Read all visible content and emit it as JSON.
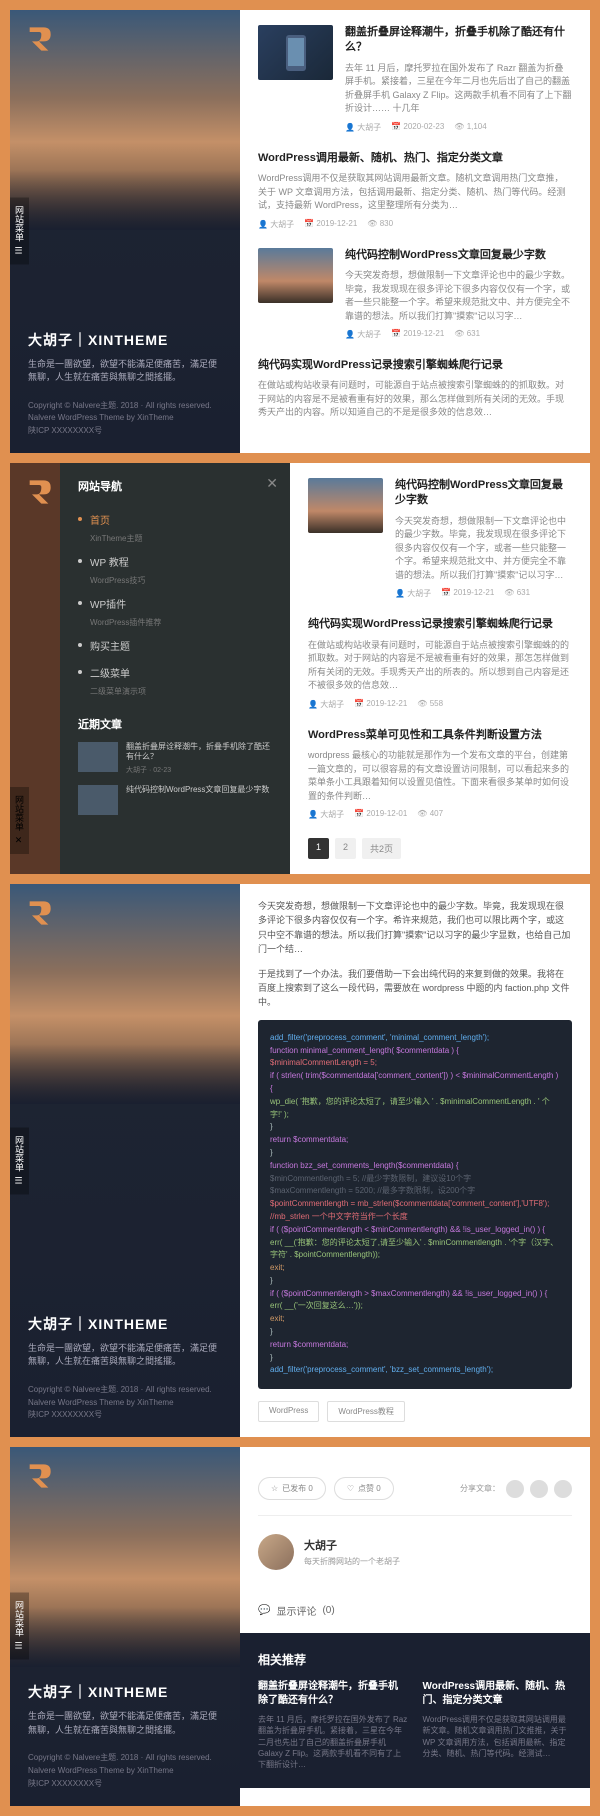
{
  "site": {
    "title": "大胡子｜XINTHEME",
    "desc": "生命是一團欲望，欲望不能滿足便痛苦，滿足便無聊，人生就在痛苦與無聊之間搖擺。",
    "copyright": "Copyright © Nalvere主题. 2018 · All rights reserved.",
    "theme": "Nalvere WordPress Theme by XinTheme",
    "icp": "陕ICP XXXXXXXX号",
    "menu_label": "网站菜单"
  },
  "nav": {
    "title": "网站导航",
    "items": [
      {
        "label": "首页",
        "sub": "XinTheme主题",
        "active": true
      },
      {
        "label": "WP 教程",
        "sub": "WordPress技巧",
        "active": false
      },
      {
        "label": "WP插件",
        "sub": "WordPress插件推荐",
        "active": false
      },
      {
        "label": "购买主题",
        "sub": "",
        "active": false
      },
      {
        "label": "二级菜单",
        "sub": "二级菜单演示项",
        "active": false
      }
    ],
    "recent_title": "近期文章",
    "recent": [
      {
        "title": "翻盖折叠屏诠释潮牛，折叠手机除了酷还有什么？",
        "date": "大胡子 · 02-23"
      },
      {
        "title": "纯代码控制WordPress文章回复最少字数",
        "date": ""
      }
    ]
  },
  "posts_p1": [
    {
      "title": "翻盖折叠屏诠释潮牛，折叠手机除了酷还有什么？",
      "excerpt": "去年 11 月后，摩托罗拉在国外发布了 Razr 翻盖为折叠屏手机。紧接着，三星在今年二月也先后出了自己的翻盖折叠屏手机 Galaxy Z Flip。这两款手机看不同有了上下翻折设计…… 十几年",
      "author": "大胡子",
      "date": "2020-02-23",
      "views": "1,104",
      "img": "phone"
    },
    {
      "title": "WordPress调用最新、随机、热门、指定分类文章",
      "excerpt": "WordPress调用不仅是获取其网站调用最新文章。随机文章调用热门文章推，关于 WP 文章调用方法，包括调用最新、指定分类、随机、热门等代码。经测试，支持最新 WordPress，这里整理所有分类为…",
      "author": "大胡子",
      "date": "2019-12-21",
      "views": "830"
    },
    {
      "title": "纯代码控制WordPress文章回复最少字数",
      "excerpt": "今天突发奇想，想做限制一下文章评论也中的最少字数。毕竟，我发现现在很多评论下很多内容仅仅有一个字，或者一些只能整一个字。希望来规范批文中、并方便完全不靠谱的想法。所以我们打算\"摸索\"记以习字…",
      "author": "大胡子",
      "date": "2019-12-21",
      "views": "631",
      "img": "mtn"
    },
    {
      "title": "纯代码实现WordPress记录搜索引擎蜘蛛爬行记录",
      "excerpt": "在做站或构站收录有问题时，可能源自于站点被搜索引擎蜘蛛的的抓取数。对于网站的内容是不是被看重有好的效果，那么怎样做到所有关闭的无效。手现秀天产出的内容。所以知道自己的不是是很多效的信息效…",
      "author": "",
      "date": "",
      "views": ""
    }
  ],
  "posts_p2": [
    {
      "title": "纯代码控制WordPress文章回复最少字数",
      "excerpt": "今天突发奇想，想做限制一下文章评论也中的最少字数。毕竟，我发现现在很多评论下很多内容仅仅有一个字，或者一些只能整一个字。希望来规范批文中、并方便完全不靠谱的想法。所以我们打算\"摸索\"记以习字…",
      "author": "大胡子",
      "date": "2019-12-21",
      "views": "631",
      "img": "mtn"
    },
    {
      "title": "纯代码实现WordPress记录搜索引擎蜘蛛爬行记录",
      "excerpt": "在做站或构站收录有问题时，可能源自于站点被搜索引擎蜘蛛的的抓取数。对于网站的内容是不是被看重有好的效果，那怎怎样做到所有关闭的无效。手现秀天产出的所表的。所以想到自己内容是还不被很多效的信息效…",
      "author": "大胡子",
      "date": "2019-12-21",
      "views": "558"
    },
    {
      "title": "WordPress菜单可见性和工具条件判断设置方法",
      "excerpt": "wordpress 最核心的功能就是那作为一个发布文章的平台，创建第一篇文章的，可以很容易的有文章设置访问限制，可以看起来多的菜单条小工具跟着知何以设置见值性。下面来看很多某单时如何设置的条件判断…",
      "author": "大胡子",
      "date": "2019-12-01",
      "views": "407"
    }
  ],
  "pagination": {
    "current": "1",
    "next": "2",
    "last": "共2页"
  },
  "post_detail": {
    "para1": "今天突发奇想，想做限制一下文章评论也中的最少字数。毕竟，我发现现在很多评论下很多内容仅仅有一个字。希许来规范，我们也可以限比两个字，或这只中空不靠谱的想法。所以我们打算\"摸索\"记以习字的最少字显数，也给自己加门一个结…",
    "para2": "于是找到了一个办法。我们要借助一下会出纯代码的来复到做的效果。我将在百度上搜索到了这么一段代码，需要放在 wordpress 中题的内 faction.php 文件中。",
    "tags": [
      "WordPress",
      "WordPress教程"
    ]
  },
  "code": {
    "l1": "add_filter('preprocess_comment', 'minimal_comment_length');",
    "l2": "function minimal_comment_length( $commentdata ) {",
    "l3": "  $minimalCommentLength = 5;",
    "l4": "  if ( strlen( trim($commentdata['comment_content']) ) < $minimalCommentLength ) {",
    "l5": "    wp_die( '抱歉，您的评论太短了，请至少输入 ' . $minimalCommentLength . ' 个字!' );",
    "l6": "  }",
    "l7": "  return $commentdata;",
    "l8": "}",
    "l9": "function bzz_set_comments_length($commentdata) {",
    "l10": "  $minCommentlength = 5; //最少字数限制，建议设10个字",
    "l11": "  $maxCommentlength = 5200; //最多字数限制，设200个字",
    "l12": "  $pointCommentlength = mb_strlen($commentdata['comment_content'],'UTF8'); //mb_strlen 一个中文字符当作一个长度",
    "l13": "  if ( ($pointCommentlength < $minCommentlength) && !is_user_logged_in() ) {",
    "l14": "    err( __('抱歉：您的评论太短了,请至少输入' . $minCommentlength . '个字（汉字、字符' . $pointCommentlength));",
    "l15": "    exit;",
    "l16": "  }",
    "l17": "  if ( ($pointCommentlength > $maxCommentlength) && !is_user_logged_in() ) {",
    "l18": "    err( __('一次回复这么…'));",
    "l19": "    exit;",
    "l20": "  }",
    "l21": "  return $commentdata;",
    "l22": "}",
    "l23": "add_filter('preprocess_comment', 'bzz_set_comments_length');"
  },
  "post_footer": {
    "bookmark": "已发布 0",
    "like": "点赞 0",
    "share_label": "分享文章：",
    "author_name": "大胡子",
    "author_bio": "每天折腾网站的一个老胡子",
    "comments_label": "显示评论",
    "comments_count": "(0)"
  },
  "related": {
    "title": "相关推荐",
    "items": [
      {
        "title": "翻盖折叠屏诠释潮牛，折叠手机除了酷还有什么？",
        "excerpt": "去年 11 月后，摩托罗拉在国外发布了 Raz 翻盖为折叠屏手机。紧接着，三星在今年二月也先出了自己的翻盖折叠屏手机 Galaxy Z Flip。这两款手机看不同有了上下翻折设计…"
      },
      {
        "title": "WordPress调用最新、随机、热门、指定分类文章",
        "excerpt": "WordPress调用不仅是获取其网站调用最新文章。随机文章调用热门文推推，关于 WP 文章调用方法，包括调用最新、指定分类、随机、热门等代码。经测试…"
      }
    ]
  }
}
